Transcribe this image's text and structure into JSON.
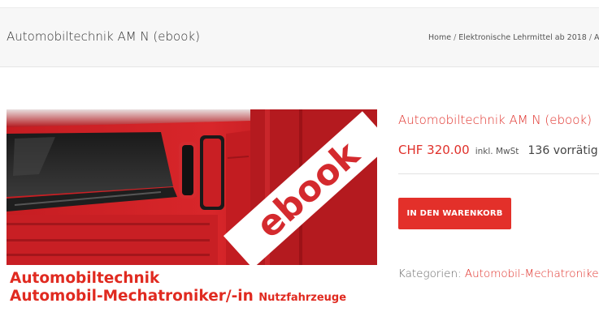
{
  "header": {
    "title": "Automobiltechnik AM N (ebook)",
    "breadcrumb": {
      "home": "Home",
      "separator": "/",
      "category": "Elektronische Lehrmittel ab 2018",
      "current": "Au"
    }
  },
  "product": {
    "image": {
      "overlay_text": "ebook",
      "caption_line1": "Automobiltechnik",
      "caption_line2": "Automobil-Mechatroniker/-in",
      "caption_line2_small": "Nutzfahrzeuge"
    },
    "title": "Automobiltechnik AM N (ebook)",
    "price": "CHF 320.00",
    "tax_note": "inkl. MwSt",
    "stock": "136 vorrätig",
    "add_to_cart_label": "IN DEN WARENKORB",
    "categories_label": "Kategorien:",
    "category_link": "Automobil-Mechatronike"
  },
  "colors": {
    "accent": "#e3302a",
    "header_bg": "#f7f7f7"
  }
}
